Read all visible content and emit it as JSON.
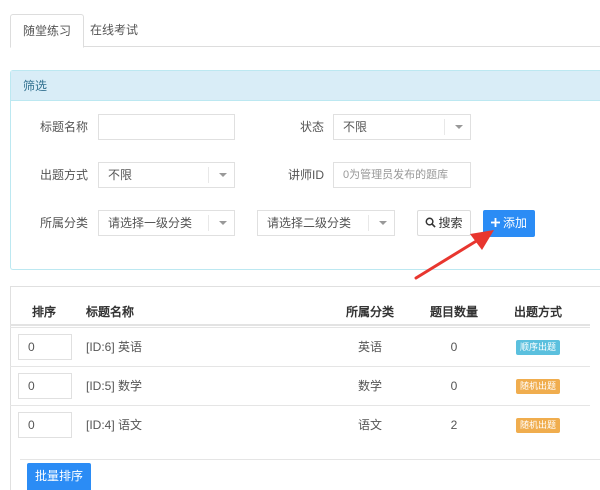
{
  "tabs": [
    {
      "label": "随堂练习",
      "active": true
    },
    {
      "label": "在线考试",
      "active": false
    }
  ],
  "filter": {
    "title": "筛选",
    "title_label": "标题名称",
    "title_value": "",
    "status_label": "状态",
    "status_value": "不限",
    "mode_label": "出题方式",
    "mode_value": "不限",
    "lecturer_label": "讲师ID",
    "lecturer_placeholder": "0为管理员发布的题库",
    "category_label": "所属分类",
    "category1_value": "请选择一级分类",
    "category2_value": "请选择二级分类",
    "search_label": "搜索",
    "add_label": "添加"
  },
  "table": {
    "headers": {
      "sort": "排序",
      "name": "标题名称",
      "category": "所属分类",
      "count": "题目数量",
      "mode": "出题方式"
    },
    "rows": [
      {
        "sort": "0",
        "name": "[ID:6] 英语",
        "category": "英语",
        "count": "0",
        "mode": "顺序出题",
        "mode_color": "#5bc0de"
      },
      {
        "sort": "0",
        "name": "[ID:5] 数学",
        "category": "数学",
        "count": "0",
        "mode": "随机出题",
        "mode_color": "#f0ad4e"
      },
      {
        "sort": "0",
        "name": "[ID:4] 语文",
        "category": "语文",
        "count": "2",
        "mode": "随机出题",
        "mode_color": "#f0ad4e"
      }
    ]
  },
  "batch_sort_label": "批量排序",
  "colors": {
    "primary": "#2b8cf5",
    "panel_head_bg": "#d9edf7",
    "panel_head_text": "#31708f",
    "annotation_arrow": "#e8362f"
  }
}
